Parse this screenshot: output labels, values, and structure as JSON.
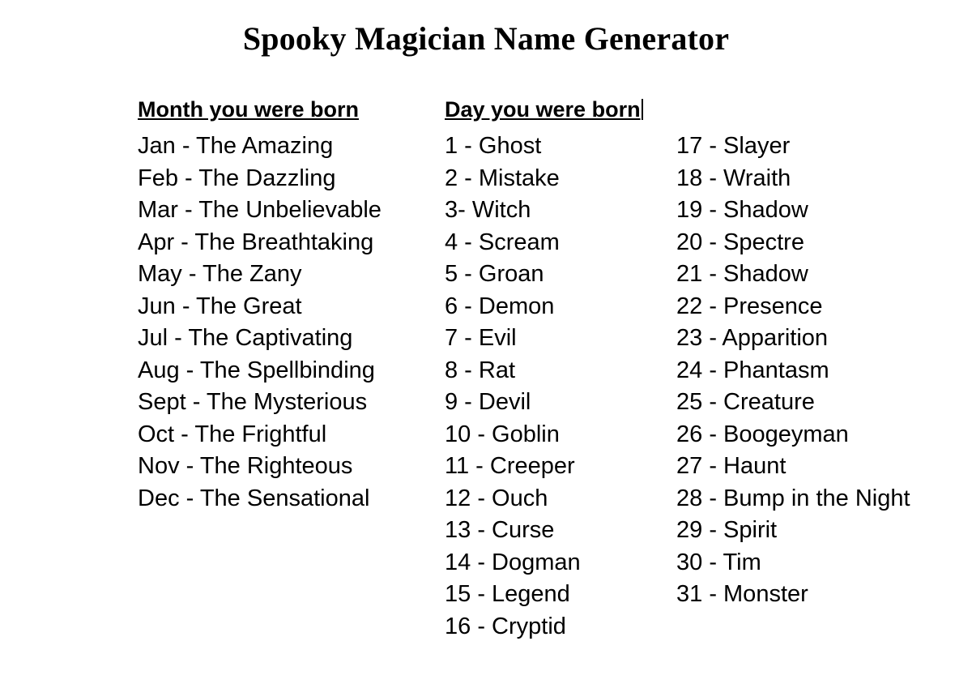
{
  "document": {
    "title": "Spooky Magician Name Generator",
    "background_color": "#ffffff",
    "text_color": "#000000"
  },
  "month_column": {
    "heading": "Month you were born",
    "items": [
      "Jan - The Amazing",
      "Feb - The Dazzling",
      "Mar - The Unbelievable",
      "Apr - The Breathtaking",
      "May - The Zany",
      "Jun - The Great",
      "Jul - The Captivating",
      "Aug - The Spellbinding",
      "Sept - The Mysterious",
      "Oct - The Frightful",
      "Nov - The Righteous",
      "Dec - The Sensational"
    ]
  },
  "day_column": {
    "heading": "Day you were born",
    "caret_visible": true,
    "items_first": [
      "1 - Ghost",
      "2 - Mistake",
      "3- Witch",
      "4 - Scream",
      "5 - Groan",
      "6 - Demon",
      "7 - Evil",
      "8 - Rat",
      "9 - Devil",
      "10 - Goblin",
      "11 - Creeper",
      "12 - Ouch",
      "13 - Curse",
      "14 - Dogman",
      "15 - Legend",
      "16 - Cryptid"
    ],
    "items_second": [
      "17 - Slayer",
      "18 - Wraith",
      "19 - Shadow",
      "20 - Spectre",
      "21 - Shadow",
      "22 - Presence",
      "23 - Apparition",
      "24 - Phantasm",
      "25 - Creature",
      "26 - Boogeyman",
      "27 - Haunt",
      "28 - Bump in the Night",
      "29 - Spirit",
      "30 - Tim",
      "31 - Monster"
    ]
  }
}
